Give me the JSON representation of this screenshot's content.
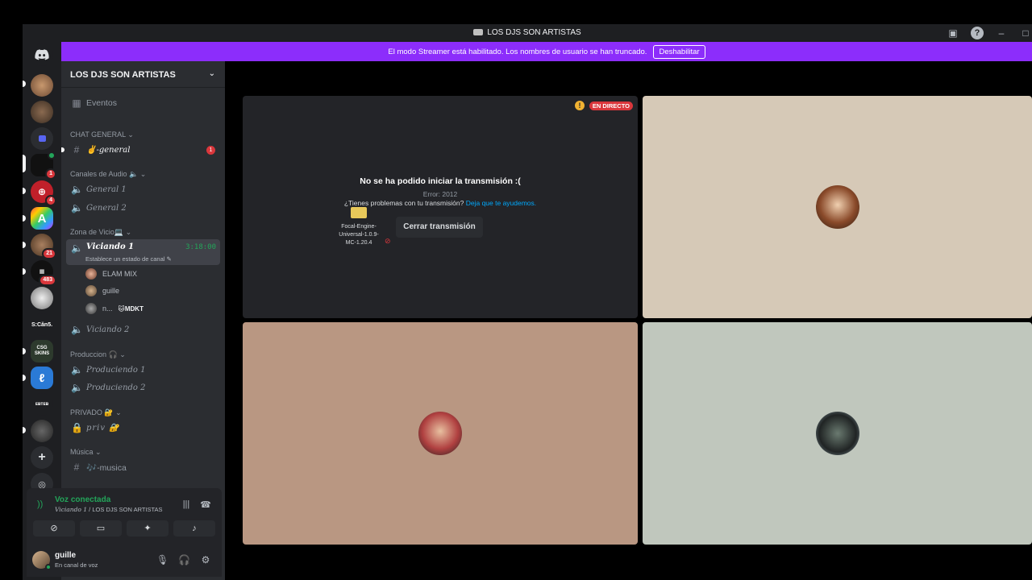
{
  "window": {
    "title": "LOS DJS SON ARTISTAS"
  },
  "streamer_bar": {
    "message": "El modo Streamer está habilitado. Los nombres de usuario se han truncado.",
    "button": "Deshabilitar"
  },
  "servers": [
    {
      "label": "",
      "badge": ""
    },
    {
      "label": "",
      "badge": ""
    },
    {
      "label": "",
      "badge": ""
    },
    {
      "label": "",
      "badge": "1"
    },
    {
      "label": "",
      "badge": "4"
    },
    {
      "label": "A",
      "badge": ""
    },
    {
      "label": "",
      "badge": "21"
    },
    {
      "label": "",
      "badge": "483"
    },
    {
      "label": "",
      "badge": ""
    },
    {
      "label": "S:Căn5.",
      "badge": ""
    },
    {
      "label": "CSG SKINS",
      "badge": ""
    },
    {
      "label": "",
      "badge": ""
    },
    {
      "label": "ᴇʙᴛᴇʙ",
      "badge": ""
    },
    {
      "label": "",
      "badge": ""
    }
  ],
  "sidebar": {
    "guild_name": "LOS DJS SON ARTISTAS",
    "events_label": "Eventos",
    "categories": {
      "chat": "CHAT GENERAL",
      "audio": "Canales de Audio 🔈",
      "zona": "Zona de Vicio💻",
      "produccion": "Produccion 🎧",
      "privado": "PRIVADO 🔐",
      "musica": "Música"
    },
    "channels": {
      "general_text": "✌️-general",
      "general_text_badge": "1",
      "general_1": "General 1",
      "general_2": "General 2",
      "viciando_1": "Viciando 1",
      "viciando_1_timer": "3:18:00",
      "viciando_1_status": "Establece un estado de canal",
      "viciando_2": "Viciando 2",
      "produciendo_1": "Produciendo 1",
      "produciendo_2": "Produciendo 2",
      "priv": "priv 🔐",
      "musica": "🎶-musica"
    },
    "members": [
      {
        "name": "ELAM MIX",
        "extra": ""
      },
      {
        "name": "guille",
        "extra": ""
      },
      {
        "name": "n...",
        "extra": "🐱MDKT"
      }
    ]
  },
  "voice_panel": {
    "status": "Voz conectada",
    "channel": "Viciando 1",
    "server": " / LOS DJS SON ARTISTAS"
  },
  "user": {
    "name": "guille",
    "status": "En canal de voz"
  },
  "stream": {
    "live_label": "EN DIRECTO",
    "error_title": "No se ha podido iniciar la transmisión :(",
    "error_code": "Error: 2012",
    "help_text": "¿Tienes problemas con tu transmisión?",
    "help_link": "Deja que te ayudemos.",
    "file_name": "Focal-Engine-Universal-1.0.9-MC-1.20.4",
    "close_button": "Cerrar transmisión"
  },
  "colors": {
    "streamer_bar": "#8c2dfb",
    "voice_green": "#23a55a",
    "live_red": "#da373c"
  }
}
